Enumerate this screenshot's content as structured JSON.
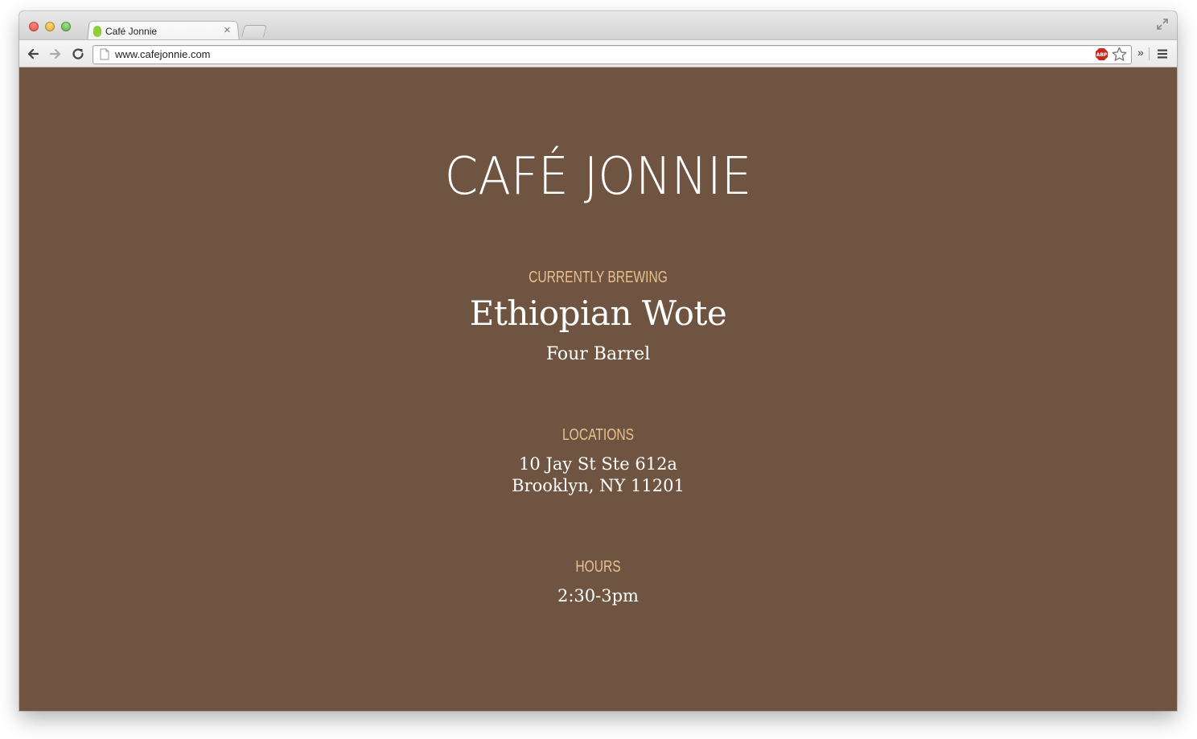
{
  "browser": {
    "tab_title": "Café Jonnie",
    "tab_close": "×",
    "url": "www.cafejonnie.com",
    "more_label": "»",
    "favicon_color": "#8fcf3a"
  },
  "site": {
    "logo": "CAFÉ JONNIE",
    "brewing_label": "CURRENTLY BREWING",
    "coffee_name": "Ethiopian Wote",
    "roaster": "Four Barrel",
    "locations_label": "LOCATIONS",
    "address_line1": "10 Jay St Ste 612a",
    "address_line2": "Brooklyn, NY 11201",
    "hours_label": "HOURS",
    "hours": "2:30-3pm",
    "background_color": "#6f5541",
    "label_color": "#e8c08e",
    "text_color": "#ffffff"
  }
}
